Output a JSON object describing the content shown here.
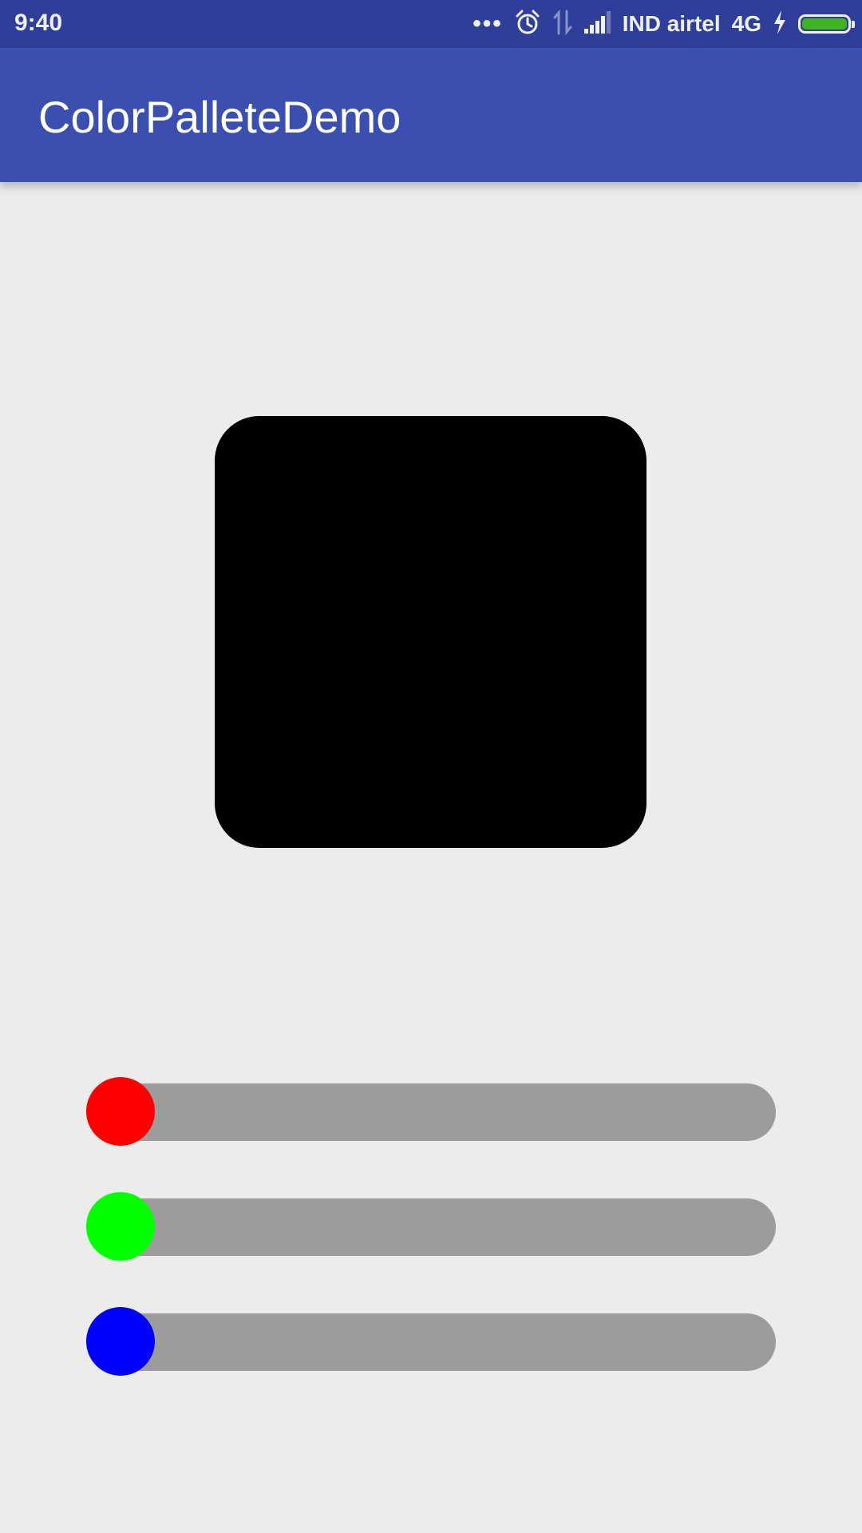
{
  "status_bar": {
    "time": "9:40",
    "more_dots": "•••",
    "carrier": "IND airtel",
    "network": "4G",
    "icons": [
      "alarm-clock-icon",
      "data-transfer-icon",
      "signal-strength-icon",
      "charging-bolt-icon",
      "battery-icon"
    ],
    "battery_level": 1.0
  },
  "app_bar": {
    "title": "ColorPalleteDemo"
  },
  "preview": {
    "color": "#000000"
  },
  "sliders": [
    {
      "channel": "red",
      "thumb_color": "#ff0000",
      "value": 0
    },
    {
      "channel": "green",
      "thumb_color": "#00ff00",
      "value": 0
    },
    {
      "channel": "blue",
      "thumb_color": "#0000ff",
      "value": 0
    }
  ],
  "colors": {
    "status_bar": "#2f3e99",
    "app_bar": "#3a4fb0",
    "background": "#ececec",
    "track": "#9c9c9c"
  }
}
